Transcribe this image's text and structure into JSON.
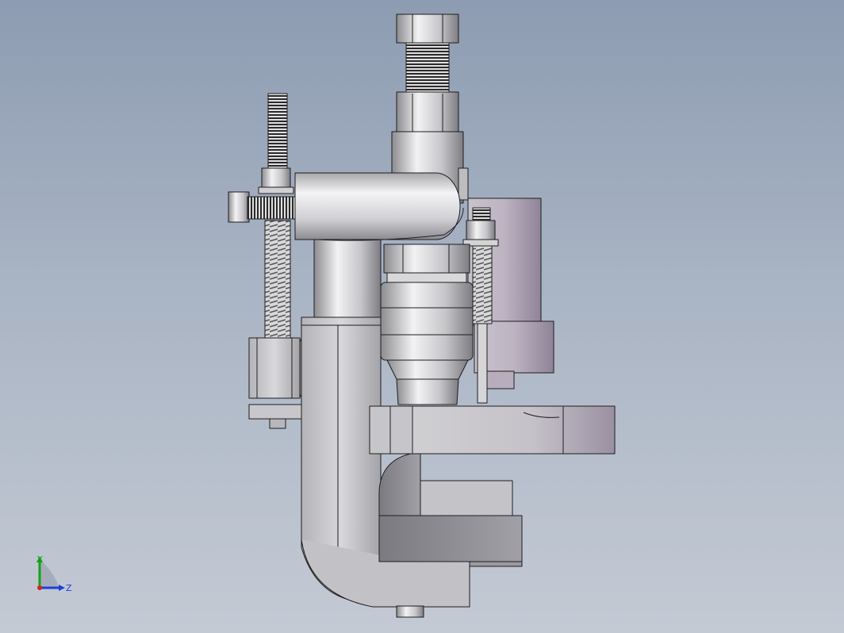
{
  "viewport": {
    "background_top": "#8d9cb2",
    "background_bottom": "#c4cad4",
    "model_edge_color": "#1e1e1e",
    "model_face_color": "#c8c8cc"
  },
  "triad": {
    "y_label": "Y",
    "z_label": "Z",
    "y_color": "#13a313",
    "z_color": "#1f3fd6",
    "x_color": "#d42020"
  }
}
